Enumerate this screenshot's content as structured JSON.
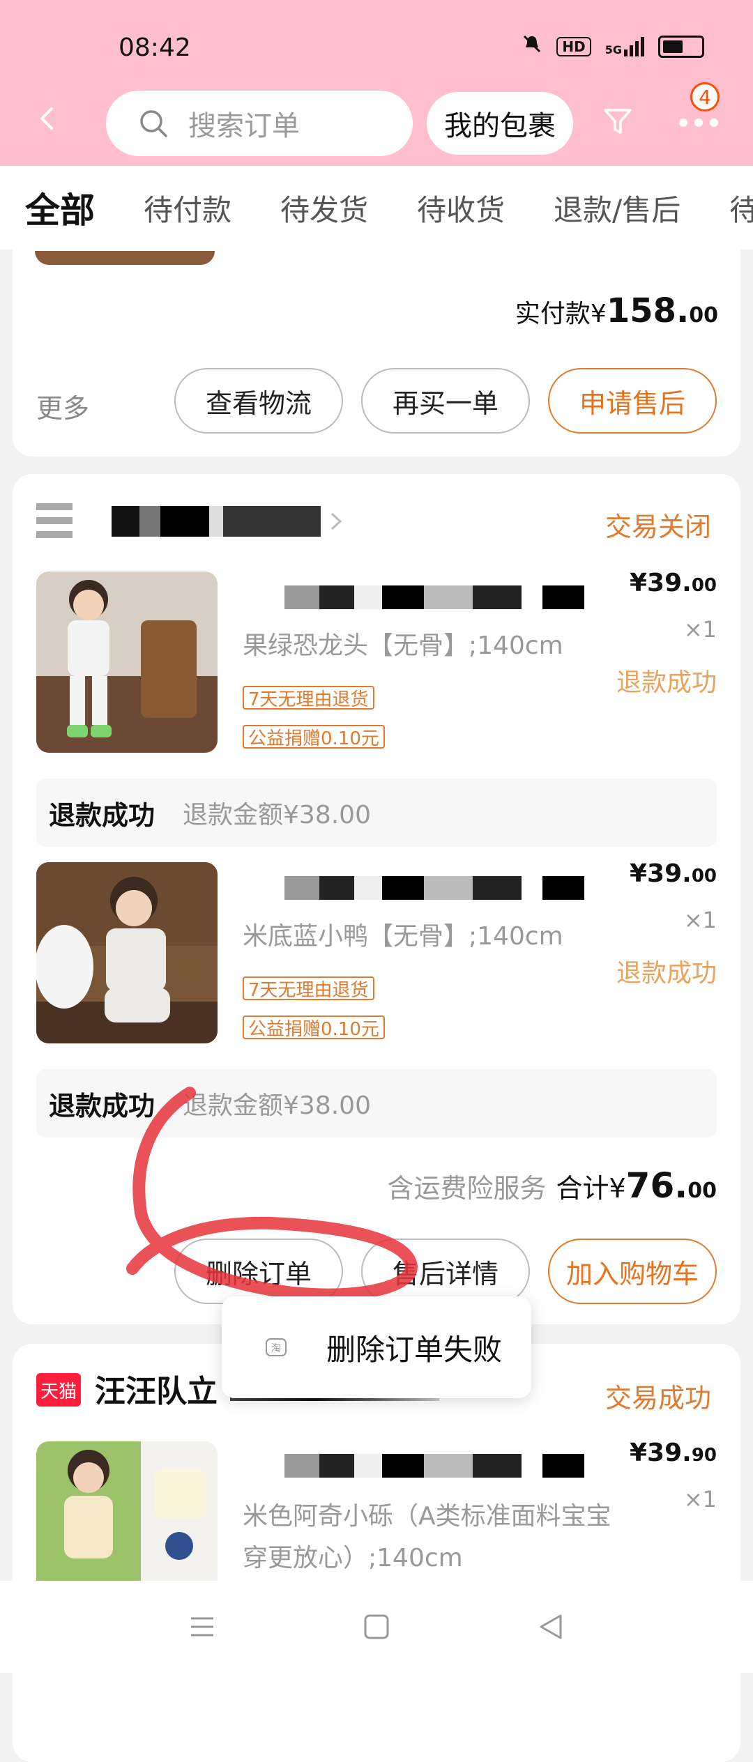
{
  "status_bar": {
    "time": "08:42",
    "hd": "HD",
    "network": "5G"
  },
  "header": {
    "search_placeholder": "搜索订单",
    "package_button": "我的包裹",
    "badge_count": "4"
  },
  "tabs": [
    "全部",
    "待付款",
    "待发货",
    "待收货",
    "退款/售后"
  ],
  "order1": {
    "paid_label": "实付款",
    "paid_currency": "¥",
    "paid_int": "158.",
    "paid_cents": "00",
    "more": "更多",
    "buttons": {
      "logistics": "查看物流",
      "rebuy": "再买一单",
      "after_sale": "申请售后"
    }
  },
  "order2": {
    "status": "交易关闭",
    "items": [
      {
        "spec": "果绿恐龙头【无骨】;140cm",
        "tags": [
          "7天无理由退货",
          "公益捐赠0.10元"
        ],
        "price_int": "¥39.",
        "price_cents": "00",
        "qty": "×1",
        "item_status": "退款成功",
        "refund_label": "退款成功",
        "refund_amount": "退款金额¥38.00"
      },
      {
        "spec": "米底蓝小鸭【无骨】;140cm",
        "tags": [
          "7天无理由退货",
          "公益捐赠0.10元"
        ],
        "price_int": "¥39.",
        "price_cents": "00",
        "qty": "×1",
        "item_status": "退款成功",
        "refund_label": "退款成功",
        "refund_amount": "退款金额¥38.00"
      }
    ],
    "service": "含运费险服务",
    "total_label": "合计",
    "total_currency": "¥",
    "total_int": "76.",
    "total_cents": "00",
    "buttons": {
      "delete": "删除订单",
      "after_sale_detail": "售后详情",
      "add_to_cart": "加入购物车"
    }
  },
  "toast": {
    "message": "删除订单失败"
  },
  "order3": {
    "platform_badge": "天猫",
    "shop_name_visible": "汪汪队立",
    "status": "交易成功",
    "item": {
      "spec": "米色阿奇小砾（A类标准面料宝宝穿更放心）;140cm",
      "price_int": "¥39.",
      "price_cents": "90",
      "qty": "×1"
    }
  },
  "colors": {
    "header_bg": "#ffbfcf",
    "accent": "#e07a2e",
    "annotation": "#e8343b"
  }
}
